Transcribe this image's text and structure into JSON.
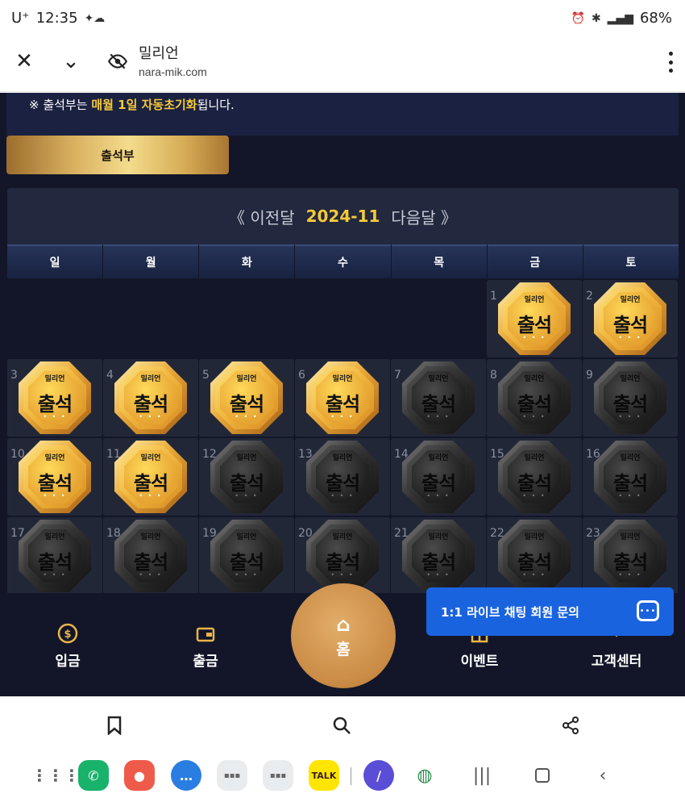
{
  "status_bar": {
    "carrier": "U⁺",
    "time": "12:35",
    "battery": "68%"
  },
  "browser": {
    "title": "밀리언",
    "url": "nara-mik.com"
  },
  "notice": {
    "prefix": "※ 출석부는 ",
    "highlight": "매월 1일 자동초기화",
    "suffix": "됩니다."
  },
  "attendance_button": "출석부",
  "calendar": {
    "prev": "《 이전달",
    "month": "2024-11",
    "next": "다음달 》",
    "weekdays": [
      "일",
      "월",
      "화",
      "수",
      "목",
      "금",
      "토"
    ],
    "badge_text": "출석",
    "badge_brand": "밀리언",
    "leading_blank_days": 5,
    "days_shown": 23,
    "attended_days": [
      1,
      2,
      3,
      4,
      5,
      6,
      10,
      11
    ]
  },
  "nav": {
    "deposit": "입금",
    "withdraw": "출금",
    "home": "홈",
    "event": "이벤트",
    "support": "고객센터"
  },
  "chat": {
    "label": "1:1 라이브 채팅 회원 문의"
  },
  "dock": {
    "talk_label": "TALK"
  }
}
